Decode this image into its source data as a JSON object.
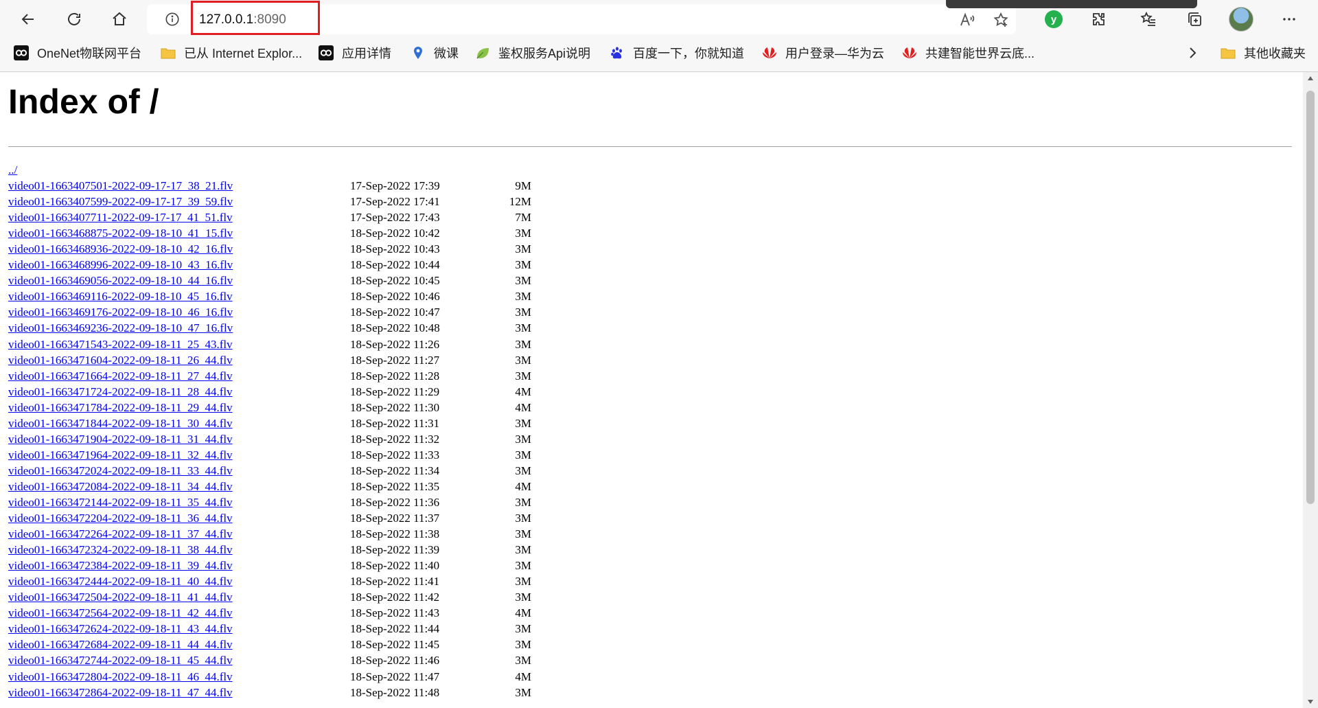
{
  "address_bar": {
    "host": "127.0.0.1",
    "port": ":8090"
  },
  "bookmarks": [
    {
      "label": "OneNet物联网平台",
      "icon": "onenet-logo-icon"
    },
    {
      "label": "已从 Internet Explor...",
      "icon": "folder-icon"
    },
    {
      "label": "应用详情",
      "icon": "onenet-logo-icon"
    },
    {
      "label": "微课",
      "icon": "weike-icon"
    },
    {
      "label": "鉴权服务Api说明",
      "icon": "leaf-icon"
    },
    {
      "label": "百度一下，你就知道",
      "icon": "baidu-paw-icon"
    },
    {
      "label": "用户登录—华为云",
      "icon": "huawei-logo-icon"
    },
    {
      "label": "共建智能世界云底...",
      "icon": "huawei-logo-icon"
    }
  ],
  "other_bookmarks": "其他收藏夹",
  "page": {
    "title": "Index of /",
    "parent_link": "../"
  },
  "listing": [
    {
      "name": "video01-1663407501-2022-09-17-17_38_21.flv",
      "date": "17-Sep-2022 17:39",
      "size": "9M"
    },
    {
      "name": "video01-1663407599-2022-09-17-17_39_59.flv",
      "date": "17-Sep-2022 17:41",
      "size": "12M"
    },
    {
      "name": "video01-1663407711-2022-09-17-17_41_51.flv",
      "date": "17-Sep-2022 17:43",
      "size": "7M"
    },
    {
      "name": "video01-1663468875-2022-09-18-10_41_15.flv",
      "date": "18-Sep-2022 10:42",
      "size": "3M"
    },
    {
      "name": "video01-1663468936-2022-09-18-10_42_16.flv",
      "date": "18-Sep-2022 10:43",
      "size": "3M"
    },
    {
      "name": "video01-1663468996-2022-09-18-10_43_16.flv",
      "date": "18-Sep-2022 10:44",
      "size": "3M"
    },
    {
      "name": "video01-1663469056-2022-09-18-10_44_16.flv",
      "date": "18-Sep-2022 10:45",
      "size": "3M"
    },
    {
      "name": "video01-1663469116-2022-09-18-10_45_16.flv",
      "date": "18-Sep-2022 10:46",
      "size": "3M"
    },
    {
      "name": "video01-1663469176-2022-09-18-10_46_16.flv",
      "date": "18-Sep-2022 10:47",
      "size": "3M"
    },
    {
      "name": "video01-1663469236-2022-09-18-10_47_16.flv",
      "date": "18-Sep-2022 10:48",
      "size": "3M"
    },
    {
      "name": "video01-1663471543-2022-09-18-11_25_43.flv",
      "date": "18-Sep-2022 11:26",
      "size": "3M"
    },
    {
      "name": "video01-1663471604-2022-09-18-11_26_44.flv",
      "date": "18-Sep-2022 11:27",
      "size": "3M"
    },
    {
      "name": "video01-1663471664-2022-09-18-11_27_44.flv",
      "date": "18-Sep-2022 11:28",
      "size": "3M"
    },
    {
      "name": "video01-1663471724-2022-09-18-11_28_44.flv",
      "date": "18-Sep-2022 11:29",
      "size": "4M"
    },
    {
      "name": "video01-1663471784-2022-09-18-11_29_44.flv",
      "date": "18-Sep-2022 11:30",
      "size": "4M"
    },
    {
      "name": "video01-1663471844-2022-09-18-11_30_44.flv",
      "date": "18-Sep-2022 11:31",
      "size": "3M"
    },
    {
      "name": "video01-1663471904-2022-09-18-11_31_44.flv",
      "date": "18-Sep-2022 11:32",
      "size": "3M"
    },
    {
      "name": "video01-1663471964-2022-09-18-11_32_44.flv",
      "date": "18-Sep-2022 11:33",
      "size": "3M"
    },
    {
      "name": "video01-1663472024-2022-09-18-11_33_44.flv",
      "date": "18-Sep-2022 11:34",
      "size": "3M"
    },
    {
      "name": "video01-1663472084-2022-09-18-11_34_44.flv",
      "date": "18-Sep-2022 11:35",
      "size": "4M"
    },
    {
      "name": "video01-1663472144-2022-09-18-11_35_44.flv",
      "date": "18-Sep-2022 11:36",
      "size": "3M"
    },
    {
      "name": "video01-1663472204-2022-09-18-11_36_44.flv",
      "date": "18-Sep-2022 11:37",
      "size": "3M"
    },
    {
      "name": "video01-1663472264-2022-09-18-11_37_44.flv",
      "date": "18-Sep-2022 11:38",
      "size": "3M"
    },
    {
      "name": "video01-1663472324-2022-09-18-11_38_44.flv",
      "date": "18-Sep-2022 11:39",
      "size": "3M"
    },
    {
      "name": "video01-1663472384-2022-09-18-11_39_44.flv",
      "date": "18-Sep-2022 11:40",
      "size": "3M"
    },
    {
      "name": "video01-1663472444-2022-09-18-11_40_44.flv",
      "date": "18-Sep-2022 11:41",
      "size": "3M"
    },
    {
      "name": "video01-1663472504-2022-09-18-11_41_44.flv",
      "date": "18-Sep-2022 11:42",
      "size": "3M"
    },
    {
      "name": "video01-1663472564-2022-09-18-11_42_44.flv",
      "date": "18-Sep-2022 11:43",
      "size": "4M"
    },
    {
      "name": "video01-1663472624-2022-09-18-11_43_44.flv",
      "date": "18-Sep-2022 11:44",
      "size": "3M"
    },
    {
      "name": "video01-1663472684-2022-09-18-11_44_44.flv",
      "date": "18-Sep-2022 11:45",
      "size": "3M"
    },
    {
      "name": "video01-1663472744-2022-09-18-11_45_44.flv",
      "date": "18-Sep-2022 11:46",
      "size": "3M"
    },
    {
      "name": "video01-1663472804-2022-09-18-11_46_44.flv",
      "date": "18-Sep-2022 11:47",
      "size": "4M"
    },
    {
      "name": "video01-1663472864-2022-09-18-11_47_44.flv",
      "date": "18-Sep-2022 11:48",
      "size": "3M"
    }
  ],
  "colors": {
    "link": "#0000ee",
    "address_highlight": "#e11d23",
    "extension_badge": "#22b14c"
  }
}
